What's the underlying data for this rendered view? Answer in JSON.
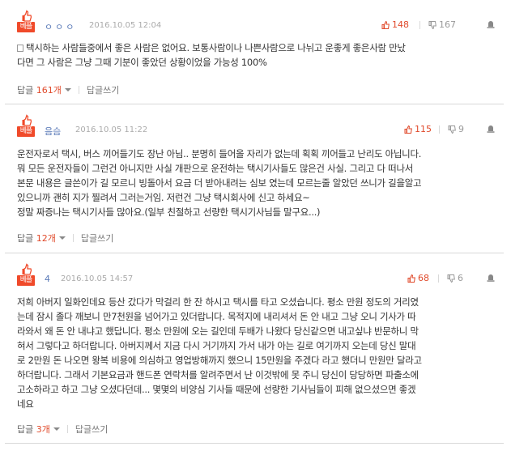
{
  "badge_label": "베플",
  "comments": [
    {
      "author": "ㅇㅇㅇ",
      "date": "2016.10.05 12:04",
      "up": "148",
      "down": "167",
      "body_lines": [
        "택시하는 사람들중에서 좋은 사람은 없어요. 보통사람이나 나쁜사람으로 나뉘고 운좋게 좋은사람 만났",
        "다면 그 사람은 그냥 그때 기분이 좋았던 상황이었을 가능성 100%"
      ],
      "reply_label": "답글",
      "reply_count": "161개",
      "write_label": "답글쓰기"
    },
    {
      "author": "음슴",
      "date": "2016.10.05 11:22",
      "up": "115",
      "down": "9",
      "body_lines": [
        "운전자로서 택시, 버스 끼어들기도 장난 아님.. 분명히 들어올 자리가 없는데 획획 끼어들고 난리도 아닙니다.",
        "뭐 모든 운전자들이 그런건 아니지만 사실 개판으로 운전하는 택시기사들도 많은건 사실. 그리고 다 떠나서",
        "본문 내용은 글쓴이가 길 모르니 빙돌아서 요금 더 받아내려는 심보 였는데 모르는줄 알았던 쓰니가 길을알고",
        "있으니까 괜히 지가 찔려서 그러는거임. 저런건 그냥 택시회사에 신고 하세요~",
        "정말 짜증나는 택시기사들 많아요.(일부 친절하고 선량한 택시기사님들 말구요...)"
      ],
      "reply_label": "답글",
      "reply_count": "12개",
      "write_label": "답글쓰기"
    },
    {
      "author": "4",
      "date": "2016.10.05 14:57",
      "up": "68",
      "down": "6",
      "body_lines": [
        "저희 아버지 일화인데요 등산 갔다가 막걸리 한 잔 하시고 택시를 타고 오셨습니다. 평소 만원 정도의 거리였",
        "는데 잠시 졸다 깨보니 만7천원을 넘어가고 있더랍니다. 목적지에 내리셔서 돈 안 내고 그냥 오니 기사가 따",
        "라와서 왜 돈 안 내냐고 했답니다. 평소 만원에 오는 길인데 두배가 나왔다 당신같으면 내고싶냐 반문하니 막",
        "혀서 그렇다고 하더랍니다. 아버지께서 지금 다시 거기까지 가서 내가 아는 길로 여기까지 오는데 당신 말대",
        "로 2만원 돈 나오면 왕복 비용에 의심하고 영업방해까지 했으니 15만원을 주겠다 라고 했더니 만원만 달라고",
        "하더랍니다. 그래서 기본요금과 핸드폰 연락처를 알려주면서 난 이것밖에 못 주니 당신이 당당하면 파출소에",
        "고소하라고 하고 그냥 오셨다던데... 몇몇의 비양심 기사들 때문에 선량한 기사님들이 피해 없으셨으면 좋겠",
        "네요"
      ],
      "reply_label": "답글",
      "reply_count": "3개",
      "write_label": "답글쓰기"
    }
  ],
  "icons": {
    "badge": "thumbs-up-best-icon",
    "up": "thumbs-up-icon",
    "down": "thumbs-down-icon",
    "report": "siren-report-icon",
    "doc": "document-icon"
  },
  "colors": {
    "badge": "#f04a2a",
    "up": "#e04a2b",
    "author": "#5a7ab8",
    "muted": "#aaaaaa"
  }
}
